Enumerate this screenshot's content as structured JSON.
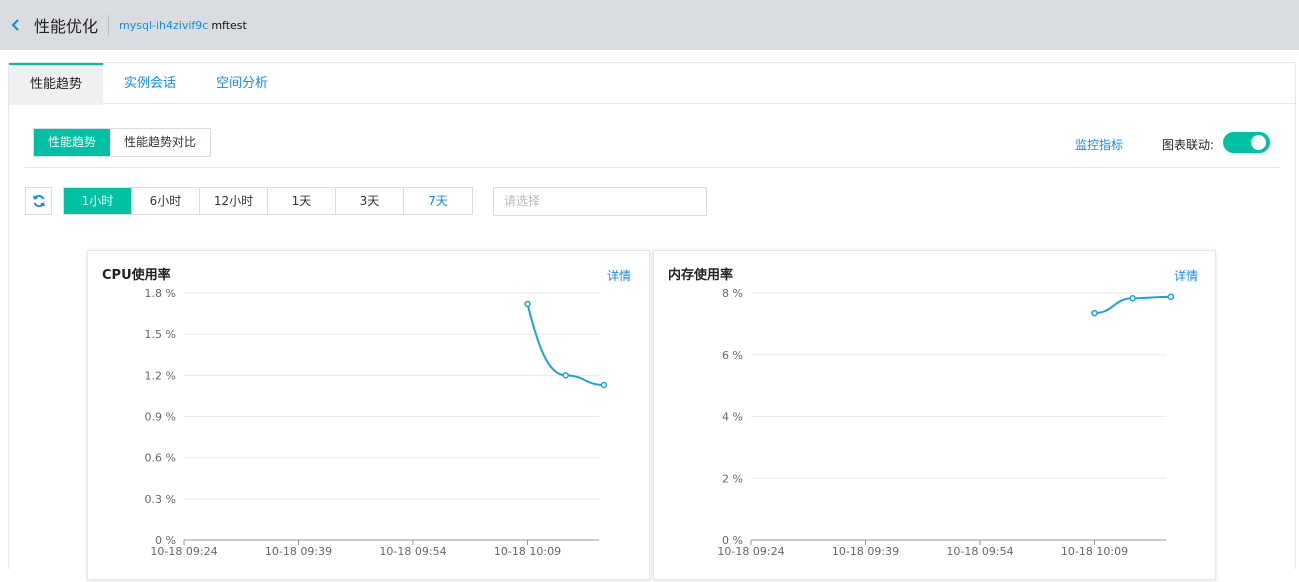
{
  "header": {
    "title": "性能优化",
    "instance_id": "mysql-ih4zivif9c",
    "instance_name": "mftest"
  },
  "tabs": [
    {
      "label": "性能趋势",
      "active": true
    },
    {
      "label": "实例会话",
      "active": false
    },
    {
      "label": "空间分析",
      "active": false
    }
  ],
  "view_switch": {
    "options": [
      "性能趋势",
      "性能趋势对比"
    ],
    "selected": "性能趋势"
  },
  "toolbar": {
    "monitor_link": "监控指标",
    "chart_link_label": "图表联动:",
    "chart_link_enabled": true
  },
  "time_range": {
    "options": [
      "1小时",
      "6小时",
      "12小时",
      "1天",
      "3天",
      "7天"
    ],
    "selected": "1小时",
    "select_placeholder": "请选择"
  },
  "colors": {
    "accent": "#00c1a3",
    "link": "#0d8fe6",
    "series": "#16a6d3"
  },
  "charts": {
    "cpu": {
      "title": "CPU使用率",
      "detail_label": "详情"
    },
    "memory": {
      "title": "内存使用率",
      "detail_label": "详情"
    }
  },
  "chart_data": [
    {
      "type": "line",
      "title": "CPU使用率",
      "ylim": [
        0,
        1.8
      ],
      "yticks": [
        "0 %",
        "0.3 %",
        "0.6 %",
        "0.9 %",
        "1.2 %",
        "1.5 %",
        "1.8 %"
      ],
      "xticks": [
        "10-18 09:24",
        "10-18 09:39",
        "10-18 09:54",
        "10-18 10:09"
      ],
      "x": [
        "10-18 10:09",
        "10-18 10:14",
        "10-18 10:19"
      ],
      "values": [
        1.72,
        1.2,
        1.13
      ]
    },
    {
      "type": "line",
      "title": "内存使用率",
      "ylim": [
        0,
        8
      ],
      "yticks": [
        "0 %",
        "2 %",
        "4 %",
        "6 %",
        "8 %"
      ],
      "xticks": [
        "10-18 09:24",
        "10-18 09:39",
        "10-18 09:54",
        "10-18 10:09"
      ],
      "x": [
        "10-18 10:09",
        "10-18 10:14",
        "10-18 10:19"
      ],
      "values": [
        7.35,
        7.83,
        7.88
      ]
    }
  ]
}
